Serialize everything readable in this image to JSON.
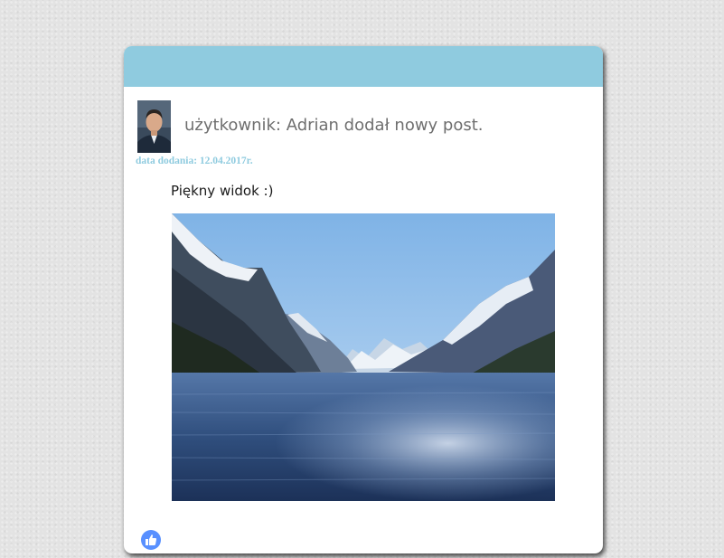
{
  "post": {
    "author_line": "użytkownik: Adrian dodał nowy post.",
    "date_line": "data dodania: 12.04.2017r.",
    "text": "Piękny widok :)",
    "image_subject": "fjord-landscape-photo",
    "avatar_subject": "user-avatar-photo",
    "like_icon": "thumbs-up-icon"
  },
  "colors": {
    "header_bar": "#8fcbdf",
    "date_text": "#8fcbdf",
    "author_text": "#6f6f6f",
    "like_button": "#5890ff",
    "page_background": "#e3e3e3"
  }
}
